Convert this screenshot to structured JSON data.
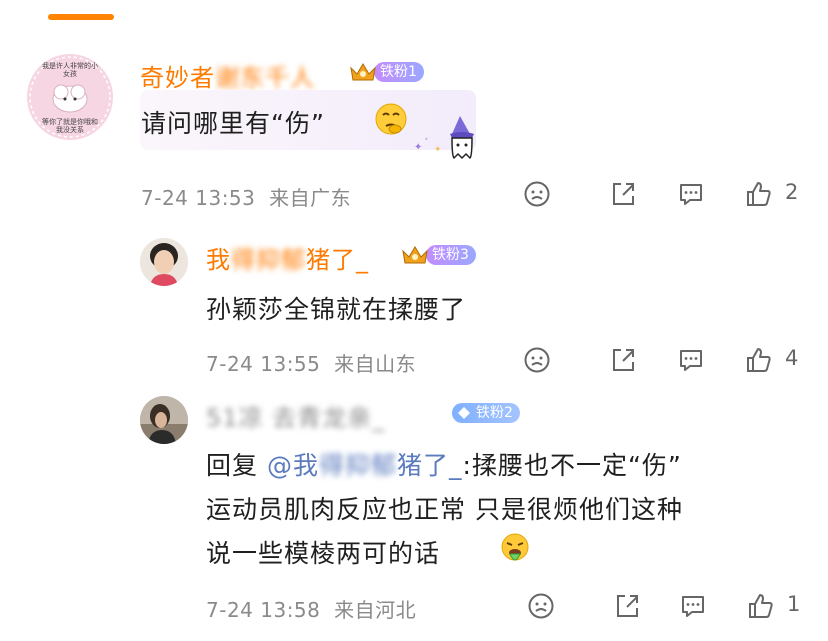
{
  "comments": [
    {
      "username_visible": "奇妙者",
      "username_blur": "谢东千人",
      "fan_badge": "铁粉1",
      "text": "请问哪里有“伤”",
      "emoji": "thinking-emoji",
      "time": "7-24 13:53",
      "location": "来自广东",
      "likes": "2",
      "avatar_text_top": "我是许人非常的小女孩",
      "avatar_text_bottom": "等你了就是你哦和我没关系"
    },
    {
      "username_visible": "我",
      "username_mid_blur": "得抑郁",
      "username_end": "猪了_",
      "fan_badge": "铁粉3",
      "text": "孙颖莎全锦就在揉腰了",
      "time": "7-24 13:55",
      "location": "来自山东",
      "likes": "4"
    },
    {
      "username_blur": "51凉 去青龙亲_",
      "fan_badge": "铁粉2",
      "reply_prefix": "回复",
      "mention_visible": "@我",
      "mention_blur": "得抑郁",
      "mention_end": "猪了_",
      "text_after_mention": ":揉腰也不一定“伤”",
      "text_line2": "运动员肌肉反应也正常 只是很烦他们这种",
      "text_line3": "说一些模棱两可的话",
      "emoji": "vomit-emoji",
      "time": "7-24 13:58",
      "location": "来自河北",
      "likes": "1"
    }
  ],
  "colors": {
    "accent": "#ff8200",
    "username": "#ff7a00",
    "mention": "#5b7bbf",
    "meta": "#8a8a8a"
  },
  "icons": [
    "frown-icon",
    "share-icon",
    "comment-icon",
    "thumbs-up-icon"
  ]
}
